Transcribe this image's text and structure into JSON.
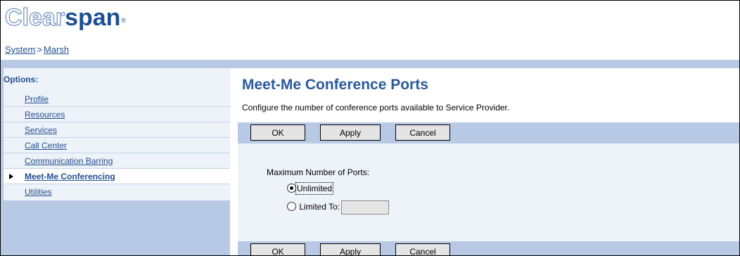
{
  "brand": {
    "part1": "Clear",
    "part2": "span",
    "reg": "®"
  },
  "breadcrumb": {
    "items": [
      "System",
      "Marsh"
    ],
    "separator": ">"
  },
  "sidebar": {
    "title": "Options:",
    "items": [
      {
        "label": "Profile"
      },
      {
        "label": "Resources"
      },
      {
        "label": "Services"
      },
      {
        "label": "Call Center"
      },
      {
        "label": "Communication Barring"
      },
      {
        "label": "Meet-Me Conferencing",
        "active": true
      },
      {
        "label": "Utilities"
      }
    ]
  },
  "page": {
    "title": "Meet-Me Conference Ports",
    "subtitle": "Configure the number of conference ports available to Service Provider."
  },
  "buttons": {
    "ok": "OK",
    "apply": "Apply",
    "cancel": "Cancel"
  },
  "form": {
    "max_label": "Maximum Number of Ports:",
    "options": [
      {
        "label": "Unlimited",
        "checked": true
      },
      {
        "label": "Limited To:",
        "checked": false,
        "value": ""
      }
    ]
  },
  "colors": {
    "accent": "#2a5a9c",
    "link": "#1f4e8f",
    "panel": "#b8c9e6",
    "panel_light": "#eef2f9"
  }
}
